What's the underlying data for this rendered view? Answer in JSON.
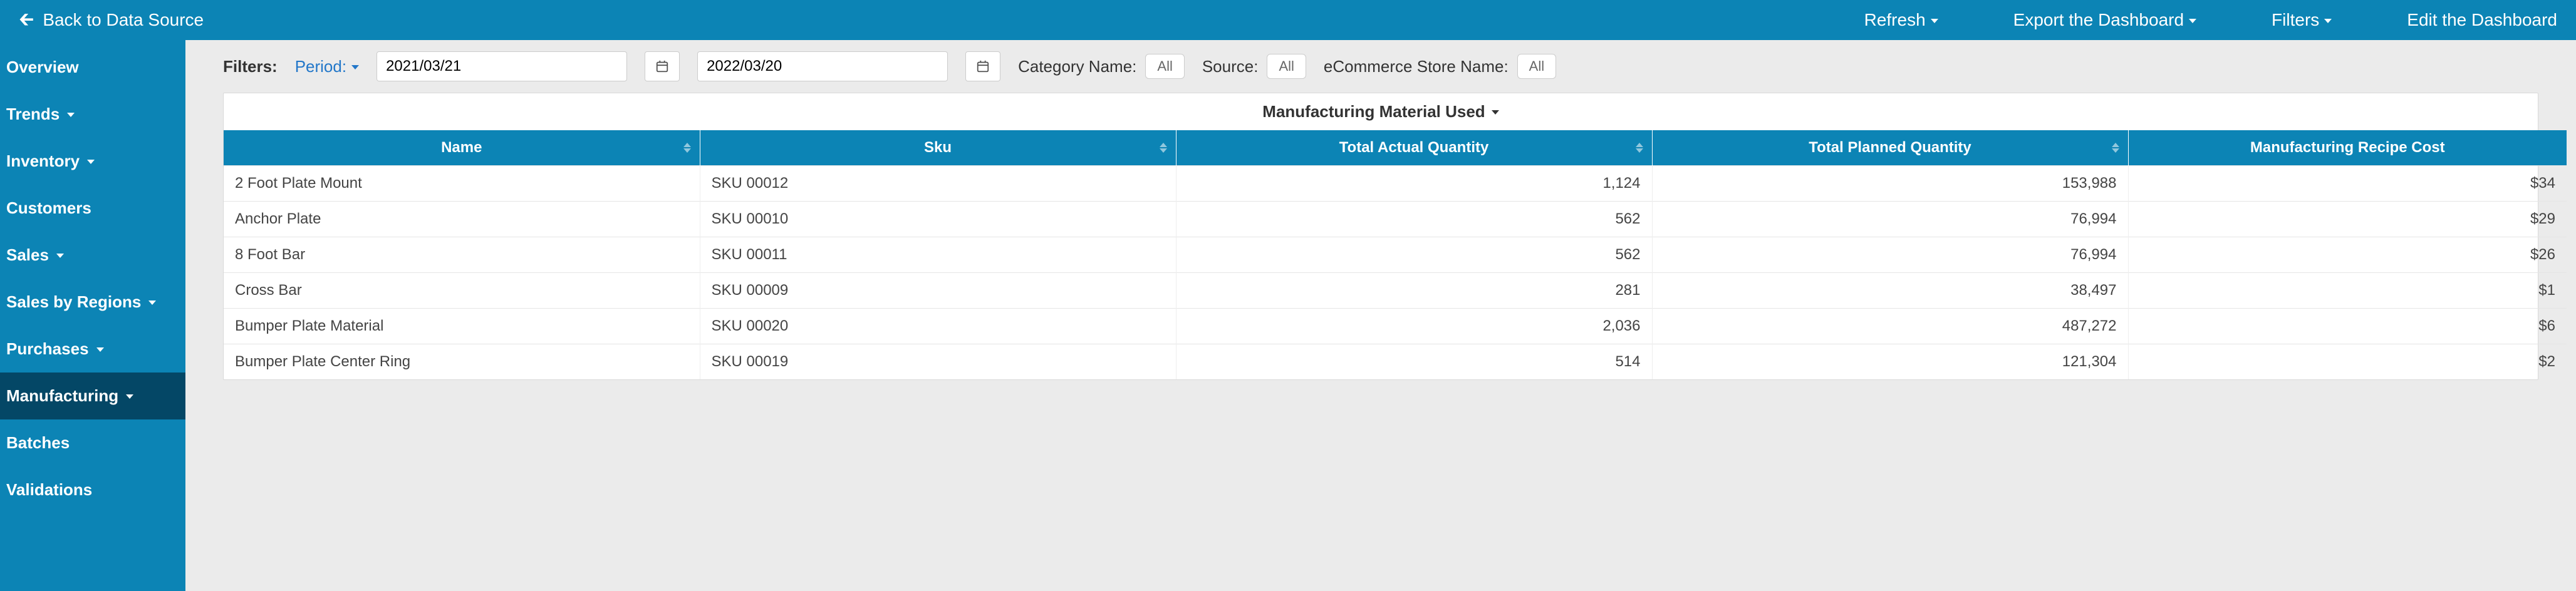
{
  "topbar": {
    "back_label": "Back to Data Source",
    "actions": {
      "refresh": "Refresh",
      "export": "Export the Dashboard",
      "filters": "Filters",
      "edit": "Edit the Dashboard"
    }
  },
  "sidebar": {
    "items": [
      {
        "label": "Overview",
        "has_caret": false
      },
      {
        "label": "Trends",
        "has_caret": true
      },
      {
        "label": "Inventory",
        "has_caret": true
      },
      {
        "label": "Customers",
        "has_caret": false
      },
      {
        "label": "Sales",
        "has_caret": true
      },
      {
        "label": "Sales by Regions",
        "has_caret": true
      },
      {
        "label": "Purchases",
        "has_caret": true
      },
      {
        "label": "Manufacturing",
        "has_caret": true,
        "active": true
      },
      {
        "label": "Batches",
        "has_caret": false
      },
      {
        "label": "Validations",
        "has_caret": false
      }
    ]
  },
  "filters": {
    "label": "Filters:",
    "period_label": "Period:",
    "date_start": "2021/03/21",
    "date_end": "2022/03/20",
    "category_label": "Category Name:",
    "category_value": "All",
    "source_label": "Source:",
    "source_value": "All",
    "store_label": "eCommerce Store Name:",
    "store_value": "All"
  },
  "panel": {
    "title": "Manufacturing Material Used",
    "columns": {
      "name": "Name",
      "sku": "Sku",
      "actual": "Total Actual Quantity",
      "planned": "Total Planned Quantity",
      "cost": "Manufacturing Recipe Cost"
    },
    "col_widths": {
      "name": "760",
      "sku": "760",
      "actual": "760",
      "planned": "760",
      "cost": "700"
    },
    "rows": [
      {
        "name": "2 Foot Plate Mount",
        "sku": "SKU 00012",
        "actual": "1,124",
        "planned": "153,988",
        "cost": "$34"
      },
      {
        "name": "Anchor Plate",
        "sku": "SKU 00010",
        "actual": "562",
        "planned": "76,994",
        "cost": "$29"
      },
      {
        "name": "8 Foot Bar",
        "sku": "SKU 00011",
        "actual": "562",
        "planned": "76,994",
        "cost": "$26"
      },
      {
        "name": "Cross Bar",
        "sku": "SKU 00009",
        "actual": "281",
        "planned": "38,497",
        "cost": "$1"
      },
      {
        "name": "Bumper Plate Material",
        "sku": "SKU 00020",
        "actual": "2,036",
        "planned": "487,272",
        "cost": "$6"
      },
      {
        "name": "Bumper Plate Center Ring",
        "sku": "SKU 00019",
        "actual": "514",
        "planned": "121,304",
        "cost": "$2"
      }
    ]
  }
}
